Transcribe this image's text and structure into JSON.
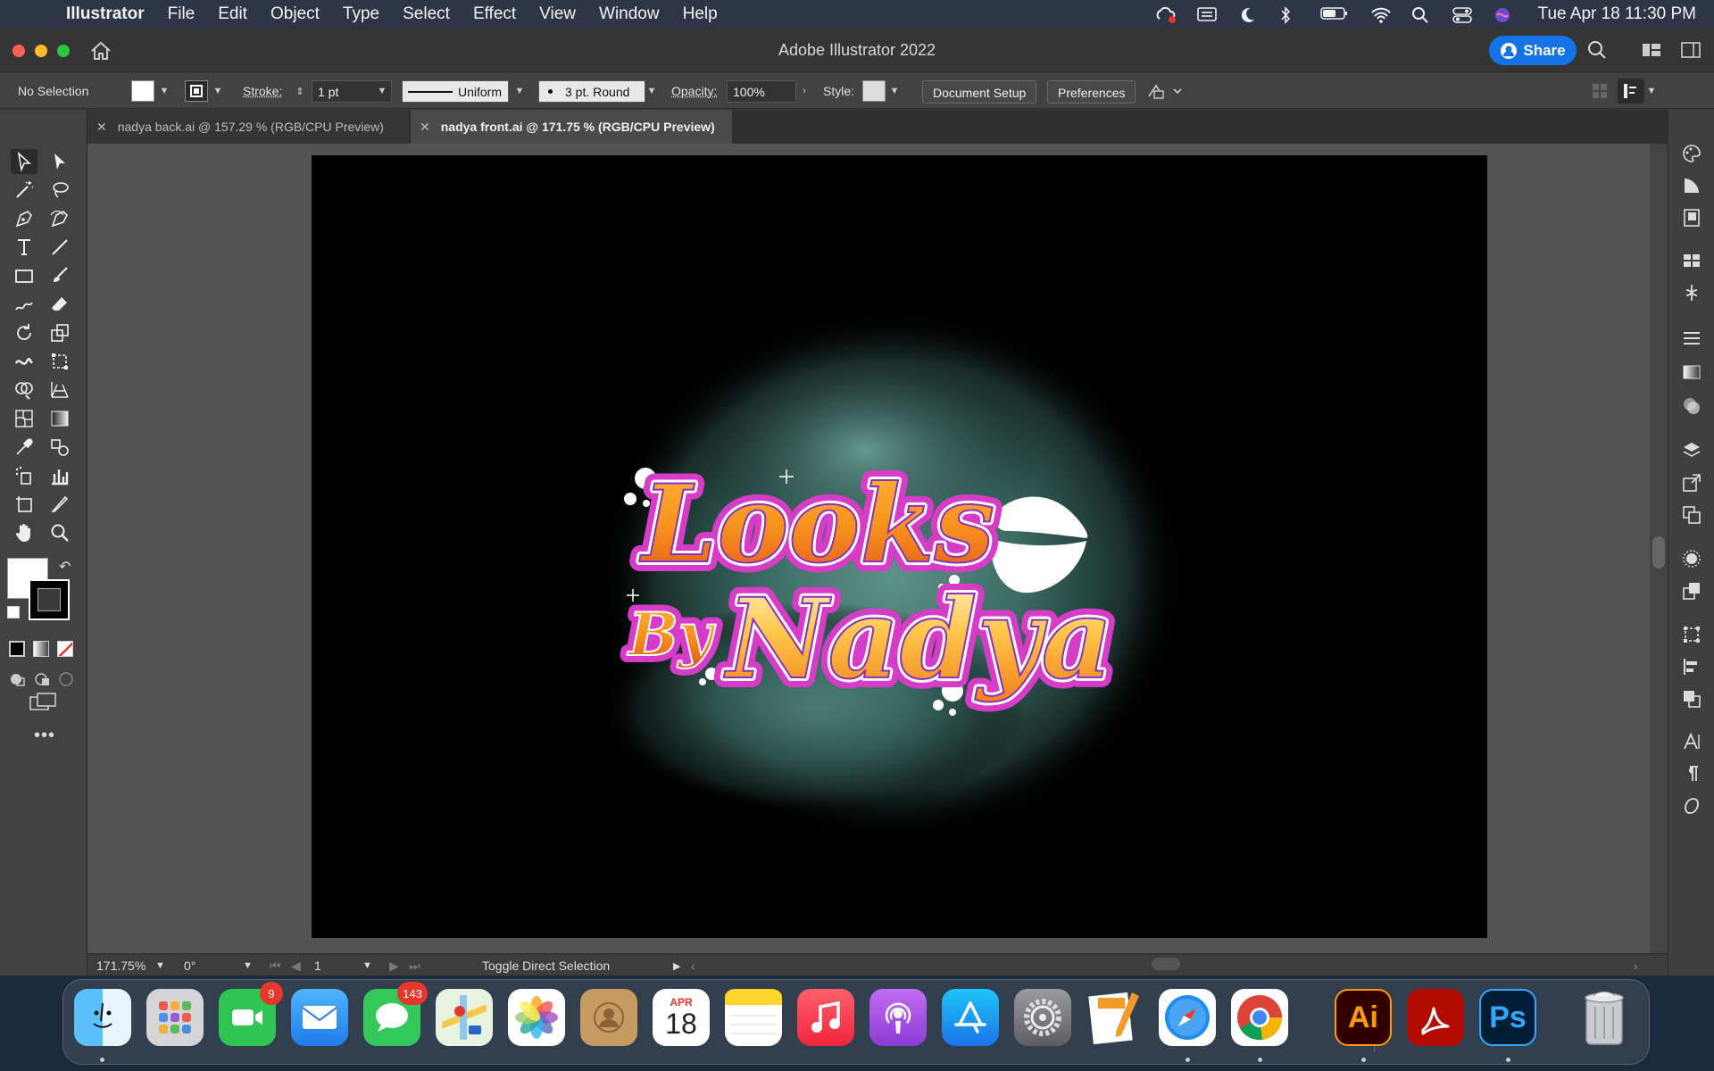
{
  "menubar": {
    "app_name": "Illustrator",
    "menus": [
      "File",
      "Edit",
      "Object",
      "Type",
      "Select",
      "Effect",
      "View",
      "Window",
      "Help"
    ],
    "clock": "Tue Apr 18  11:30 PM"
  },
  "titlebar": {
    "title": "Adobe Illustrator 2022",
    "share_label": "Share"
  },
  "controlbar": {
    "selection_status": "No Selection",
    "stroke_label": "Stroke:",
    "stroke_weight": "1 pt",
    "stroke_profile": "Uniform",
    "brush": "3 pt. Round",
    "opacity_label": "Opacity:",
    "opacity_value": "100%",
    "style_label": "Style:",
    "document_setup_label": "Document Setup",
    "preferences_label": "Preferences"
  },
  "tabs": [
    {
      "label": "nadya back.ai @ 157.29 % (RGB/CPU Preview)",
      "active": false
    },
    {
      "label": "nadya front.ai @ 171.75 % (RGB/CPU Preview)",
      "active": true
    }
  ],
  "artwork": {
    "line1": "Looks",
    "line2_prefix": "By",
    "line2": "Nadya"
  },
  "statusbar": {
    "zoom": "171.75%",
    "rotation": "0°",
    "artboard_number": "1",
    "status_text": "Toggle Direct Selection"
  },
  "dock": {
    "facetime_badge": "9",
    "messages_badge": "143",
    "calendar_month": "APR",
    "calendar_day": "18",
    "illustrator_label": "Ai",
    "photoshop_label": "Ps"
  },
  "colors": {
    "share_blue": "#1473e6",
    "logo_orange": "#f7941d",
    "logo_pink": "#d63cc8",
    "smoke_teal": "#3d6b63"
  }
}
